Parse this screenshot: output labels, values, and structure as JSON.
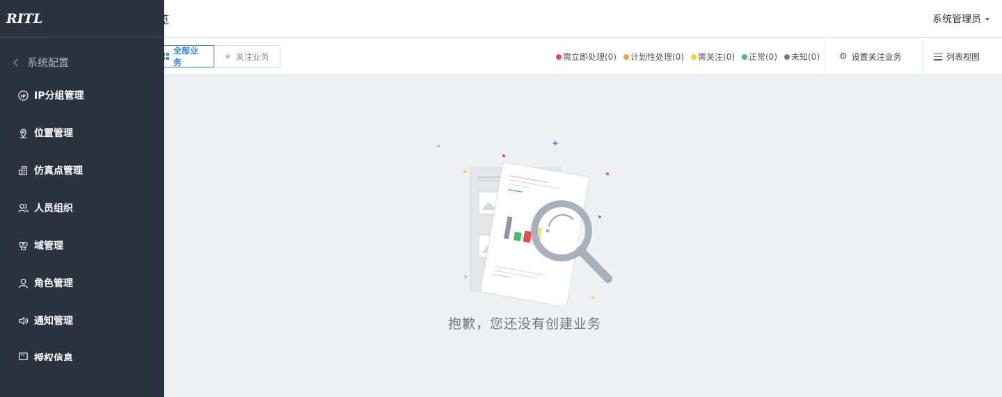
{
  "header": {
    "page_title": "览",
    "user_name": "系统管理员"
  },
  "toolbar": {
    "tabs": [
      {
        "label": "全部业务",
        "active": true
      },
      {
        "label": "关注业务",
        "active": false
      }
    ],
    "legend": [
      {
        "label": "需立即处理(0)",
        "color": "#e84a4a"
      },
      {
        "label": "计划性处理(0)",
        "color": "#f0a33a"
      },
      {
        "label": "需关注(0)",
        "color": "#f2d13c"
      },
      {
        "label": "正常(0)",
        "color": "#3fc06b"
      },
      {
        "label": "未知(0)",
        "color": "#777777"
      }
    ],
    "set_follow_label": "设置关注业务",
    "list_view_label": "列表视图"
  },
  "sidebar": {
    "logo": "RITL",
    "back_label": "系统配置",
    "items": [
      {
        "label": "IP分组管理",
        "icon": "ip-icon"
      },
      {
        "label": "位置管理",
        "icon": "location-icon"
      },
      {
        "label": "仿真点管理",
        "icon": "building-icon"
      },
      {
        "label": "人员组织",
        "icon": "people-icon"
      },
      {
        "label": "域管理",
        "icon": "domain-icon"
      },
      {
        "label": "角色管理",
        "icon": "user-icon"
      },
      {
        "label": "通知管理",
        "icon": "speaker-icon"
      },
      {
        "label": "授权信息",
        "icon": "license-icon"
      }
    ]
  },
  "empty_state": {
    "message": "抱歉，您还没有创建业务"
  },
  "colors": {
    "accent": "#2f88e8",
    "sidebar_bg": "#2c3340",
    "content_bg": "#eef0f3"
  }
}
